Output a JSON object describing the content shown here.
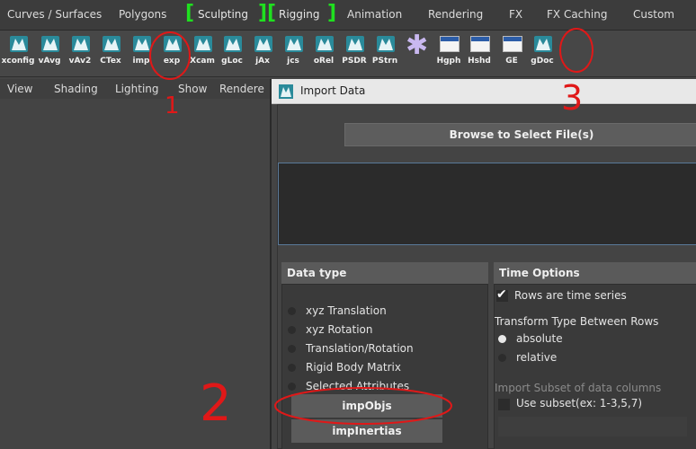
{
  "menu_tabs": [
    {
      "label": "Curves / Surfaces"
    },
    {
      "label": "Polygons"
    },
    {
      "label": "Sculpting"
    },
    {
      "label": "Rigging"
    },
    {
      "label": "Animation"
    },
    {
      "label": "Rendering"
    },
    {
      "label": "FX"
    },
    {
      "label": "FX Caching"
    },
    {
      "label": "Custom"
    }
  ],
  "shelf": [
    {
      "label": "xconfig",
      "icon": "maya-icon"
    },
    {
      "label": "vAvg",
      "icon": "maya-icon"
    },
    {
      "label": "vAv2",
      "icon": "maya-icon"
    },
    {
      "label": "CTex",
      "icon": "maya-icon"
    },
    {
      "label": "imp",
      "icon": "maya-icon"
    },
    {
      "label": "exp",
      "icon": "maya-icon"
    },
    {
      "label": "Xcam",
      "icon": "maya-icon"
    },
    {
      "label": "gLoc",
      "icon": "maya-icon"
    },
    {
      "label": "jAx",
      "icon": "maya-icon"
    },
    {
      "label": "jcs",
      "icon": "maya-icon"
    },
    {
      "label": "oRel",
      "icon": "maya-icon"
    },
    {
      "label": "PSDR",
      "icon": "maya-icon"
    },
    {
      "label": "PStrn",
      "icon": "maya-icon"
    },
    {
      "label": "",
      "icon": "asterisk-icon"
    },
    {
      "label": "Hgph",
      "icon": "window-icon"
    },
    {
      "label": "Hshd",
      "icon": "window-icon"
    },
    {
      "label": "GE",
      "icon": "window-icon"
    },
    {
      "label": "gDoc",
      "icon": "maya-icon"
    }
  ],
  "panel_menu": [
    "View",
    "Shading",
    "Lighting",
    "Show",
    "Rendere"
  ],
  "dialog": {
    "title": "Import Data",
    "browse_label": "Browse to Select File(s)",
    "data_type": {
      "heading": "Data type",
      "options": [
        {
          "label": "xyz Translation",
          "selected": false
        },
        {
          "label": "xyz Rotation",
          "selected": false
        },
        {
          "label": "Translation/Rotation",
          "selected": false
        },
        {
          "label": "Rigid Body Matrix",
          "selected": false
        },
        {
          "label": "Selected Attributes",
          "selected": false
        }
      ],
      "btn_impobjs": "impObjs",
      "btn_impinertias": "impInertias"
    },
    "time_options": {
      "heading": "Time Options",
      "rows_time_series": {
        "label": "Rows are time series",
        "checked": true
      },
      "transform_heading": "Transform Type Between Rows",
      "transform_options": [
        {
          "label": "absolute",
          "selected": true
        },
        {
          "label": "relative",
          "selected": false
        }
      ],
      "subset_heading": "Import Subset of data columns",
      "use_subset": {
        "label": "Use subset(ex: 1-3,5,7)",
        "checked": false
      }
    }
  },
  "annotations": [
    "1",
    "2",
    "3"
  ],
  "colors": {
    "annotation": "#e01818",
    "bracket": "#1fe01f",
    "maya_icon": "#2a8a9a"
  }
}
